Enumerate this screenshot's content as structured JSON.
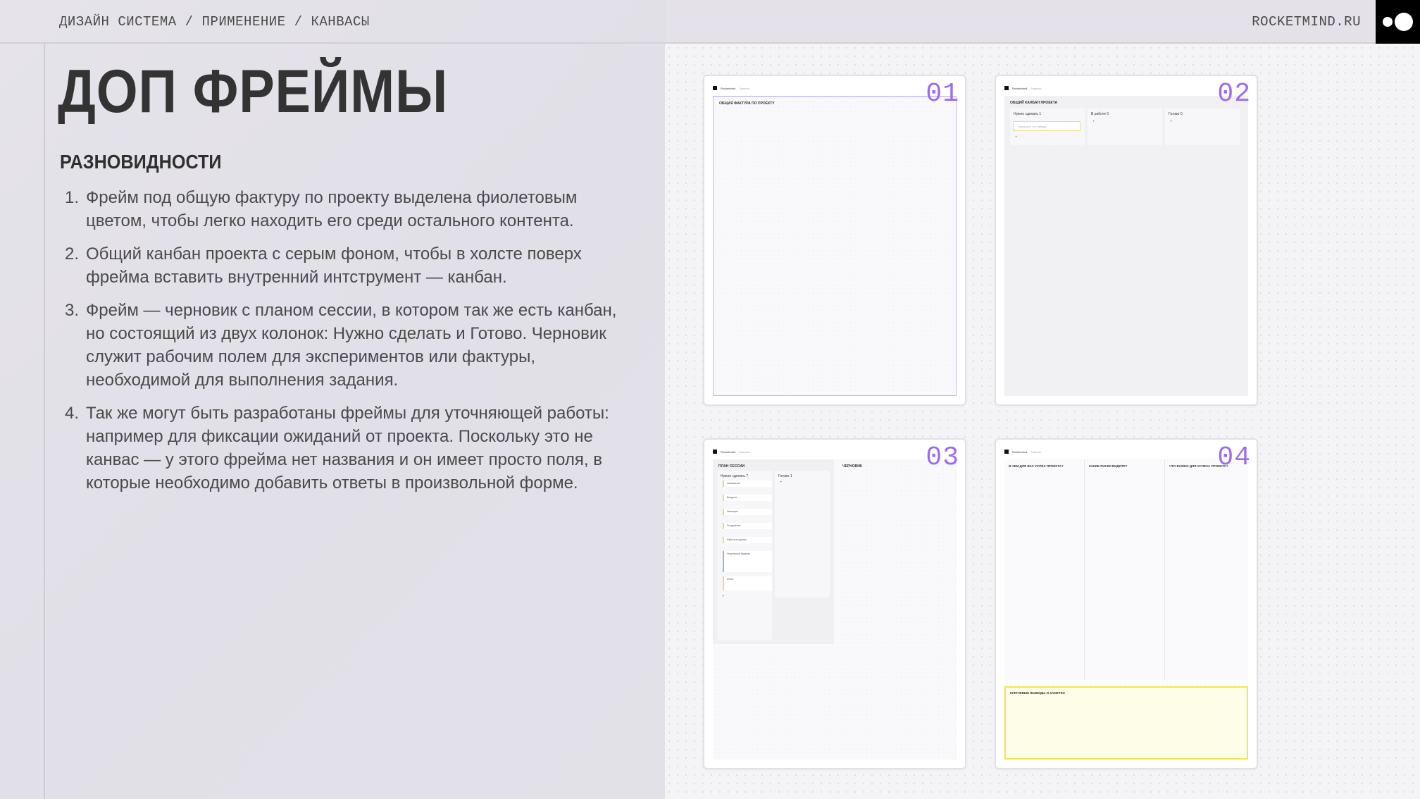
{
  "header": {
    "breadcrumb": [
      "ДИЗАЙН СИСТЕМА",
      "ПРИМЕНЕНИЕ",
      "КАНВАСЫ"
    ],
    "separator": "/",
    "site": "ROCKETMIND.RU"
  },
  "content": {
    "title": "ДОП ФРЕЙМЫ",
    "section_title": "РАЗНОВИДНОСТИ",
    "items": [
      {
        "num": "1.",
        "text": "Фрейм под общую фактуру по проекту выделена фиолетовым цветом, чтобы легко находить его среди остального контента."
      },
      {
        "num": "2.",
        "text": "Общий канбан проекта с серым фоном, чтобы в холсте поверх фрейма вставить внутренний интструмент — канбан."
      },
      {
        "num": "3.",
        "text": "Фрейм — черновик с планом сессии, в котором так же есть канбан, но состоящий из двух колонок: Нужно сделать и Готово. Черновик служит рабочим полем для экспериментов или фактуры, необходимой для выполнения задания."
      },
      {
        "num": "4.",
        "text": "Так же могут быть разработаны фреймы для уточняющей работы: например для фиксации ожиданий от проекта. Поскольку это не канвас — у этого фрейма нет названия и он имеет просто поля, в которые необходимо добавить ответы в произвольной форме."
      }
    ]
  },
  "frames": {
    "f1": {
      "num": "01",
      "head": "Rocketmind",
      "head2": "Заметки",
      "label": "ОБЩАЯ ФАКТУРА ПО ПРОЕКТУ"
    },
    "f2": {
      "num": "02",
      "head": "Rocketmind",
      "head2": "Заметки",
      "label": "ОБЩИЙ КАНБАН ПРОЕКТА",
      "columns": [
        "Нужно сделать 1",
        "В работе 0",
        "Готово 0"
      ],
      "input_placeholder": "Напишите что-нибудь",
      "plus": "+"
    },
    "f3": {
      "num": "03",
      "head": "Rocketmind",
      "head2": "Заметки",
      "plan_label": "ПЛАН СЕССИИ",
      "draft_label": "ЧЕРНОВИК",
      "columns": [
        "Нужно сделать 7",
        "Готово 1"
      ],
      "tasks": [
        "Знакомство",
        "Вводная",
        "Фиксация",
        "Погружение",
        "Работа в группах",
        "Финальные задания",
        "Итоги"
      ],
      "plus": "+"
    },
    "f4": {
      "num": "04",
      "head": "Rocketmind",
      "head2": "Заметки",
      "questions": [
        "В ЧЕМ ДЛЯ ВАС УСПЕХ ПРОЕКТА?",
        "КАКИЕ РИСКИ ВИДИТЕ?",
        "ЧТО ВАЖНО ДЛЯ УСПЕХА ПРОЕКТА?"
      ],
      "notes_label": "КЛЮЧЕВЫЕ ВЫВОДЫ И ЗАМЕТКИ"
    }
  },
  "colors": {
    "accent_purple": "#9b6cf0",
    "notes_yellow": "#f0e64a",
    "logo_bg": "#000000"
  }
}
